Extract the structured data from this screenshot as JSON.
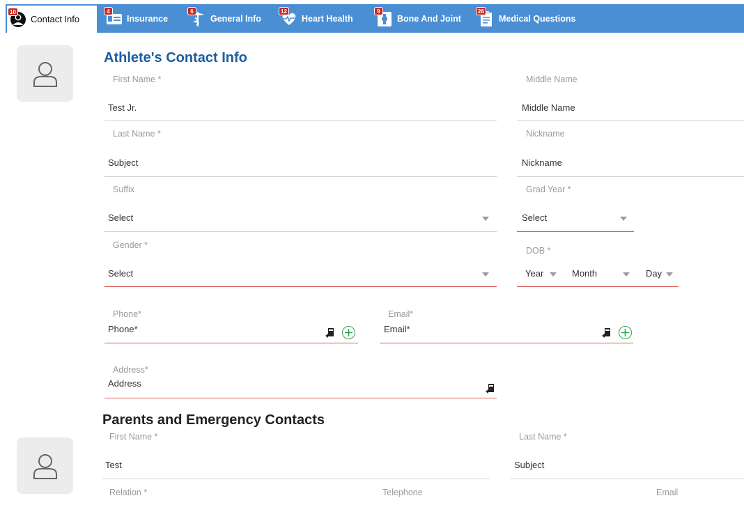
{
  "tabs": [
    {
      "label": "Contact Info",
      "badge": "10",
      "icon": "athlete-icon"
    },
    {
      "label": "Insurance",
      "badge": "4",
      "icon": "insurance-card-icon"
    },
    {
      "label": "General Info",
      "badge": "6",
      "icon": "caduceus-icon"
    },
    {
      "label": "Heart Health",
      "badge": "12",
      "icon": "heart-pulse-icon"
    },
    {
      "label": "Bone And Joint",
      "badge": "9",
      "icon": "bone-joint-icon"
    },
    {
      "label": "Medical Questions",
      "badge": "26",
      "icon": "clipboard-icon"
    }
  ],
  "athlete": {
    "title": "Athlete's Contact Info",
    "first_name": {
      "label": "First Name *",
      "value": "Test Jr."
    },
    "middle_name": {
      "label": "Middle Name",
      "placeholder": "Middle Name"
    },
    "last_name": {
      "label": "Last Name *",
      "value": "Subject"
    },
    "nickname": {
      "label": "Nickname",
      "placeholder": "Nickname"
    },
    "suffix": {
      "label": "Suffix",
      "value": "Select"
    },
    "grad_year": {
      "label": "Grad Year *",
      "value": "Select"
    },
    "gender": {
      "label": "Gender *",
      "value": "Select"
    },
    "dob": {
      "label": "DOB *",
      "year": "Year",
      "month": "Month",
      "day": "Day"
    },
    "phone": {
      "label": "Phone*",
      "placeholder": "Phone*"
    },
    "email": {
      "label": "Email*",
      "placeholder": "Email*"
    },
    "address": {
      "label": "Address*",
      "placeholder": "Address"
    }
  },
  "parents": {
    "title": "Parents and Emergency Contacts",
    "first_name": {
      "label": "First Name *",
      "value": "Test"
    },
    "last_name": {
      "label": "Last Name *",
      "value": "Subject"
    },
    "relation": {
      "label": "Relation *"
    },
    "telephone": {
      "label": "Telephone"
    },
    "email": {
      "label": "Email"
    }
  },
  "colors": {
    "tab_bar": "#4a8fd4",
    "title": "#1d5c9e",
    "required_line": "#d65a5a",
    "add": "#2ea44f",
    "badge": "#c62828"
  }
}
